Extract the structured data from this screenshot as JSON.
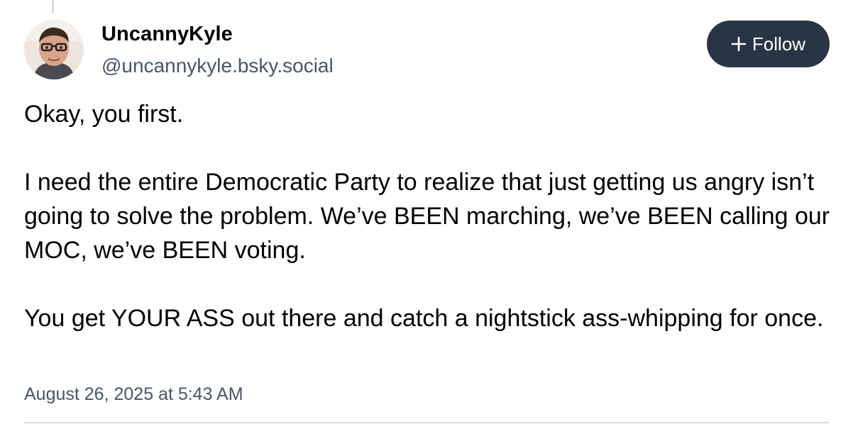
{
  "author": {
    "display_name": "UncannyKyle",
    "handle": "@uncannykyle.bsky.social",
    "avatar_icon": "profile-photo"
  },
  "follow_button": {
    "icon": "plus-icon",
    "label": "Follow"
  },
  "post": {
    "paragraphs": [
      "Okay, you first.",
      "I need the entire Democratic Party to realize that just getting us angry isn’t going to solve the problem. We’ve BEEN marching, we’ve BEEN calling our MOC, we’ve BEEN voting.",
      "You get YOUR ASS out there and catch a nightstick ass-whipping for once."
    ],
    "timestamp": "August 26, 2025 at 5:43 AM"
  },
  "colors": {
    "button_bg": "#283545",
    "secondary_text": "#45566b",
    "divider": "#d4dbe2"
  }
}
